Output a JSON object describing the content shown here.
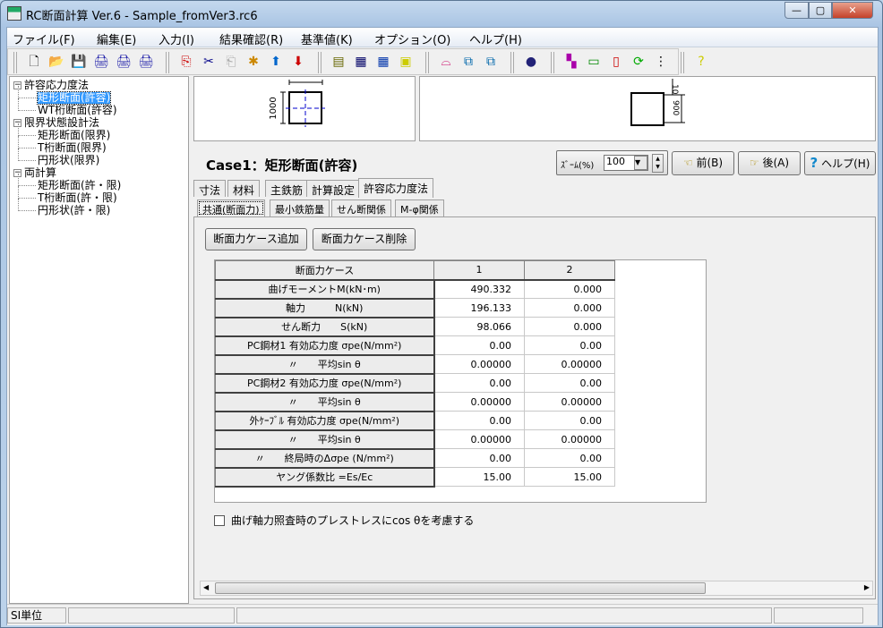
{
  "window": {
    "title": "RC断面計算 Ver.6 - Sample_fromVer3.rc6",
    "minimize": "—",
    "maximize": "▢",
    "close": "✕"
  },
  "menu": [
    "ファイル(F)",
    "編集(E)",
    "入力(I)",
    "結果確認(R)",
    "基準値(K)",
    "オプション(O)",
    "ヘルプ(H)"
  ],
  "toolbar": [
    {
      "name": "new-file-icon",
      "glyph": "🗋",
      "color": "#000"
    },
    {
      "name": "open-folder-icon",
      "glyph": "📂",
      "color": "#c90"
    },
    {
      "name": "save-icon",
      "glyph": "💾",
      "color": "#000"
    },
    {
      "name": "print-icon",
      "glyph": "🖨",
      "color": "#22a"
    },
    {
      "name": "print-preview-icon",
      "glyph": "🖨",
      "color": "#22a"
    },
    {
      "name": "print-setup-icon",
      "glyph": "🖨",
      "color": "#22a"
    },
    {
      "name": "copy-icon",
      "glyph": "⎘",
      "color": "#c00"
    },
    {
      "name": "cut-icon",
      "glyph": "✂",
      "color": "#008"
    },
    {
      "name": "paste-disabled-icon",
      "glyph": "⎗",
      "color": "#aaa"
    },
    {
      "name": "clear-icon",
      "glyph": "✱",
      "color": "#c80"
    },
    {
      "name": "move-up-icon",
      "glyph": "⬆",
      "color": "#06c"
    },
    {
      "name": "move-down-icon",
      "glyph": "⬇",
      "color": "#c00"
    },
    {
      "name": "input-data-icon",
      "glyph": "▤",
      "color": "#660"
    },
    {
      "name": "table-icon",
      "glyph": "▦",
      "color": "#006"
    },
    {
      "name": "table-blue-icon",
      "glyph": "▦",
      "color": "#03a"
    },
    {
      "name": "printer-report-icon",
      "glyph": "▣",
      "color": "#cc0"
    },
    {
      "name": "chart-icon",
      "glyph": "⌓",
      "color": "#c06"
    },
    {
      "name": "calc-icon",
      "glyph": "⧉",
      "color": "#06a"
    },
    {
      "name": "calc2-icon",
      "glyph": "⧉",
      "color": "#06a"
    },
    {
      "name": "globe-icon",
      "glyph": "●",
      "color": "#227"
    },
    {
      "name": "color-icon",
      "glyph": "▚",
      "color": "#a0a"
    },
    {
      "name": "monitor-icon",
      "glyph": "▭",
      "color": "#080"
    },
    {
      "name": "document-icon",
      "glyph": "▯",
      "color": "#c00"
    },
    {
      "name": "refresh-icon",
      "glyph": "⟳",
      "color": "#0a0"
    },
    {
      "name": "tree-icon",
      "glyph": "⋮",
      "color": "#000"
    },
    {
      "name": "help-icon",
      "glyph": "?",
      "color": "#cc0"
    }
  ],
  "tree": [
    {
      "label": "許容応力度法",
      "level": 0,
      "expand": "−"
    },
    {
      "label": "矩形断面(許容)",
      "level": 1,
      "selected": true
    },
    {
      "label": "WT桁断面(許容)",
      "level": 1
    },
    {
      "label": "限界状態設計法",
      "level": 0,
      "expand": "−"
    },
    {
      "label": "矩形断面(限界)",
      "level": 1
    },
    {
      "label": "T桁断面(限界)",
      "level": 1
    },
    {
      "label": "円形状(限界)",
      "level": 1
    },
    {
      "label": "両計算",
      "level": 0,
      "expand": "−"
    },
    {
      "label": "矩形断面(許・限)",
      "level": 1
    },
    {
      "label": "T桁断面(許・限)",
      "level": 1
    },
    {
      "label": "円形状(許・限)",
      "level": 1
    }
  ],
  "preview": {
    "left_dim": "1000",
    "right_dim_top": "10",
    "right_dim_side": "900"
  },
  "case_title": "Case1：矩形断面(許容)",
  "zoom": {
    "label": "ｽﾞｰﾑ(%)",
    "value": "100"
  },
  "nav": {
    "prev": "前(B)",
    "next": "後(A)",
    "help": "ヘルプ(H)"
  },
  "tabs": [
    "寸法",
    "材料",
    "主鉄筋",
    "計算設定",
    "許容応力度法"
  ],
  "active_tab": 4,
  "subtabs": [
    "共通(断面力)",
    "最小鉄筋量",
    "せん断関係",
    "M-φ関係"
  ],
  "buttons": {
    "add": "断面力ケース追加",
    "delete": "断面力ケース削除"
  },
  "table": {
    "header": [
      "断面力ケース",
      "1",
      "2"
    ],
    "rows": [
      [
        "曲げモーメントM(kN･m)",
        "490.332",
        "0.000"
      ],
      [
        "軸力　　　N(kN)",
        "196.133",
        "0.000"
      ],
      [
        "せん断力　　S(kN)",
        "98.066",
        "0.000"
      ],
      [
        "PC鋼材1 有効応力度 σpe(N/mm²)",
        "0.00",
        "0.00"
      ],
      [
        "〃　　平均sin θ",
        "0.00000",
        "0.00000"
      ],
      [
        "PC鋼材2 有効応力度 σpe(N/mm²)",
        "0.00",
        "0.00"
      ],
      [
        "〃　　平均sin θ",
        "0.00000",
        "0.00000"
      ],
      [
        "外ｹｰﾌﾞﾙ 有効応力度 σpe(N/mm²)",
        "0.00",
        "0.00"
      ],
      [
        "〃　　平均sin θ",
        "0.00000",
        "0.00000"
      ],
      [
        "〃　　終局時のΔσpe (N/mm²)",
        "0.00",
        "0.00"
      ],
      [
        "ヤング係数比 =Es/Ec",
        "15.00",
        "15.00"
      ]
    ]
  },
  "checkbox": {
    "label": "曲げ軸力照査時のプレストレスにcos θを考慮する",
    "checked": false
  },
  "status": {
    "unit": "SI単位"
  }
}
